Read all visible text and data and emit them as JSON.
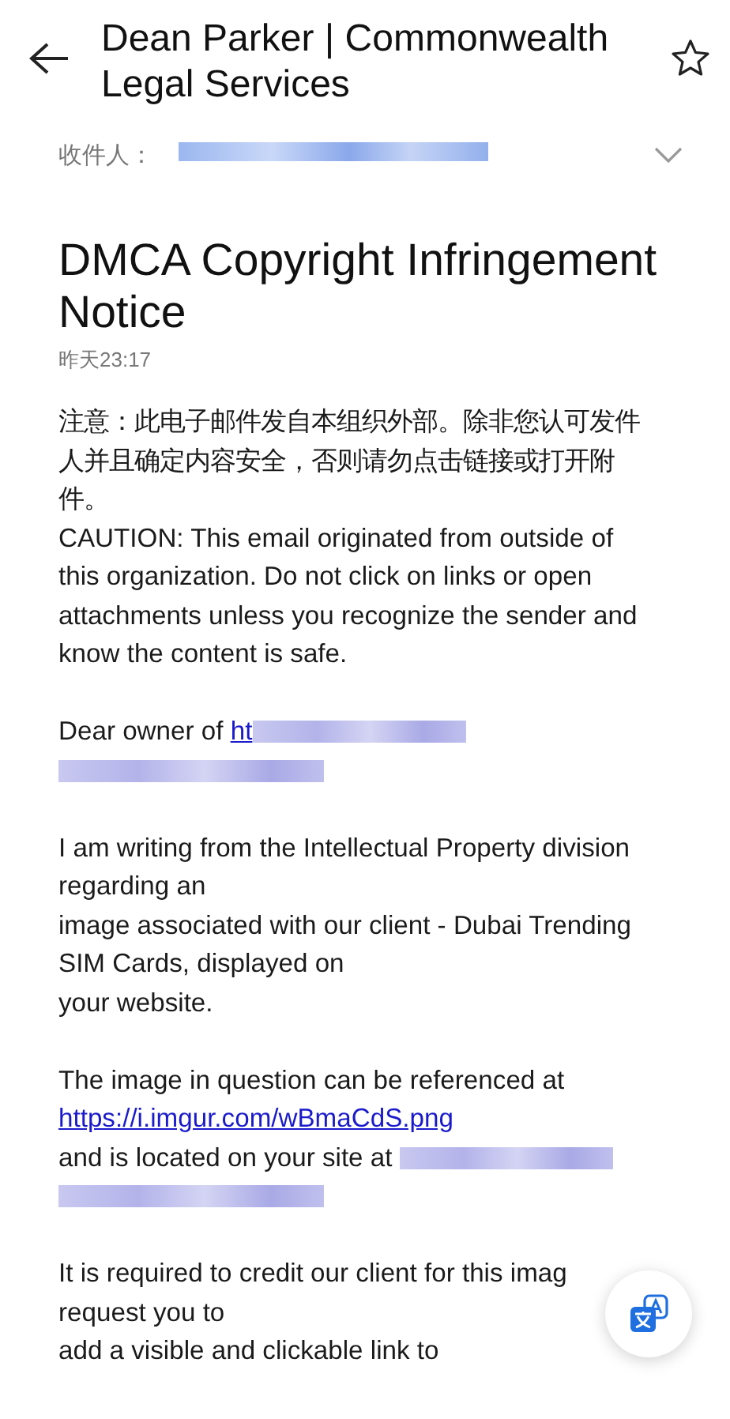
{
  "header": {
    "sender": "Dean Parker | Commonwealth Legal Services",
    "starred": false
  },
  "recipient": {
    "label": "收件人：",
    "address": {
      "kind": "redacted"
    }
  },
  "subject": "DMCA Copyright Infringement Notice",
  "date": "昨天23:17",
  "body": [
    {
      "gap": false,
      "lines": [
        [
          {
            "kind": "text",
            "text": "注意：此电子邮件发自本组织外部。除非您认可发件"
          }
        ],
        [
          {
            "kind": "text",
            "text": "人并且确定内容安全，否则请勿点击链接或打开附"
          }
        ],
        [
          {
            "kind": "text",
            "text": "件。"
          }
        ],
        [
          {
            "kind": "text",
            "text": "CAUTION: This email originated from outside of"
          }
        ],
        [
          {
            "kind": "text",
            "text": "this organization. Do not click on links or open"
          }
        ],
        [
          {
            "kind": "text",
            "text": "attachments unless you recognize the sender and"
          }
        ],
        [
          {
            "kind": "text",
            "text": "know the content is safe."
          }
        ]
      ]
    },
    {
      "gap": true,
      "lines": [
        [
          {
            "kind": "text",
            "text": "Dear owner of "
          },
          {
            "kind": "link",
            "text": "ht"
          },
          {
            "kind": "redacted"
          }
        ],
        [
          {
            "kind": "redacted"
          }
        ]
      ]
    },
    {
      "gap": false,
      "lines": [
        [
          {
            "kind": "text",
            "text": "I am writing from the Intellectual Property division"
          }
        ],
        [
          {
            "kind": "text",
            "text": "regarding an"
          }
        ],
        [
          {
            "kind": "text",
            "text": "image associated with our client - Dubai Trending"
          }
        ],
        [
          {
            "kind": "text",
            "text": "SIM Cards, displayed on"
          }
        ],
        [
          {
            "kind": "text",
            "text": "your website."
          }
        ]
      ]
    },
    {
      "gap": false,
      "lines": [
        [
          {
            "kind": "text",
            "text": "The image in question can be referenced at"
          }
        ],
        [
          {
            "kind": "link",
            "text": "https://i.imgur.com/wBmaCdS.png"
          }
        ],
        [
          {
            "kind": "text",
            "text": "and is located on your site at "
          },
          {
            "kind": "redacted"
          }
        ],
        [
          {
            "kind": "redacted"
          }
        ]
      ]
    },
    {
      "gap": false,
      "lines": [
        [
          {
            "kind": "text",
            "text": "It is required to credit our client for this imag"
          }
        ],
        [
          {
            "kind": "text",
            "text": "request you to"
          }
        ],
        [
          {
            "kind": "text",
            "text": "add a visible and clickable link to"
          }
        ]
      ]
    }
  ]
}
